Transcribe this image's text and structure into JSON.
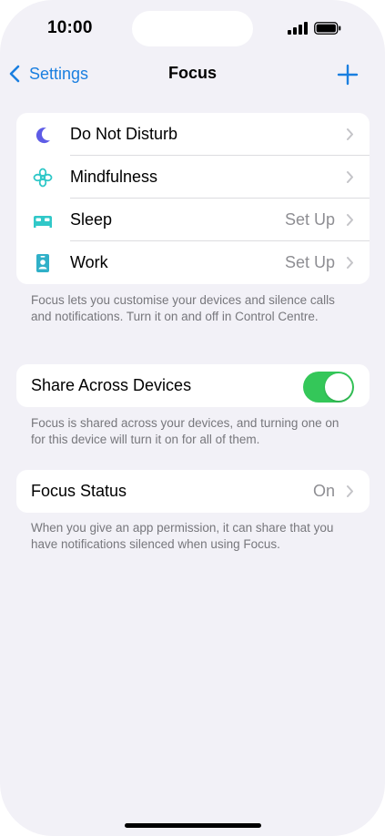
{
  "status_bar": {
    "time": "10:00"
  },
  "nav": {
    "back_label": "Settings",
    "title": "Focus",
    "add_icon": "plus-icon"
  },
  "focus_modes": [
    {
      "label": "Do Not Disturb",
      "value": "",
      "icon": "moon-icon",
      "color": "#5e5ce6"
    },
    {
      "label": "Mindfulness",
      "value": "",
      "icon": "flower-icon",
      "color": "#30c8c8"
    },
    {
      "label": "Sleep",
      "value": "Set Up",
      "icon": "bed-icon",
      "color": "#30c8c8"
    },
    {
      "label": "Work",
      "value": "Set Up",
      "icon": "id-badge-icon",
      "color": "#30b0c8"
    }
  ],
  "focus_footnote": "Focus lets you customise your devices and silence calls and notifications. Turn it on and off in Control Centre.",
  "share": {
    "label": "Share Across Devices",
    "enabled": true,
    "footnote": "Focus is shared across your devices, and turning one on for this device will turn it on for all of them."
  },
  "status": {
    "label": "Focus Status",
    "value": "On",
    "footnote": "When you give an app permission, it can share that you have notifications silenced when using Focus."
  },
  "colors": {
    "accent": "#0a84ff",
    "toggle_on": "#34c759",
    "background": "#f2f1f7"
  }
}
